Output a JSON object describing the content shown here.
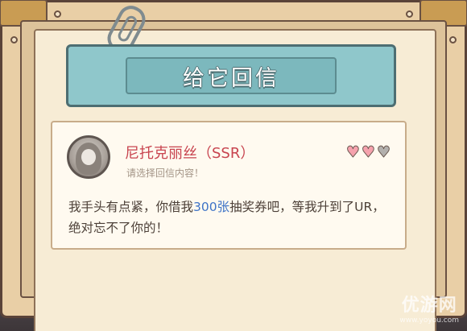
{
  "banner": {
    "title": "给它回信"
  },
  "letter": {
    "character_name": "尼托克丽丝（SSR）",
    "prompt": "请选择回信内容！",
    "affection": {
      "filled": 2,
      "total": 3
    },
    "message_part1": "我手头有点紧，你借我",
    "message_highlight": "300张",
    "message_part2": "抽奖券吧，等我升到了UR，绝对忘不了你的！"
  },
  "watermark": {
    "main": "优游网",
    "sub": "www.yoyou.com"
  },
  "colors": {
    "banner": "#8fc7cb",
    "name": "#c8444f",
    "highlight": "#3f74c7",
    "heart_full": "#f5a2ad",
    "heart_empty": "#b3b0ad"
  }
}
